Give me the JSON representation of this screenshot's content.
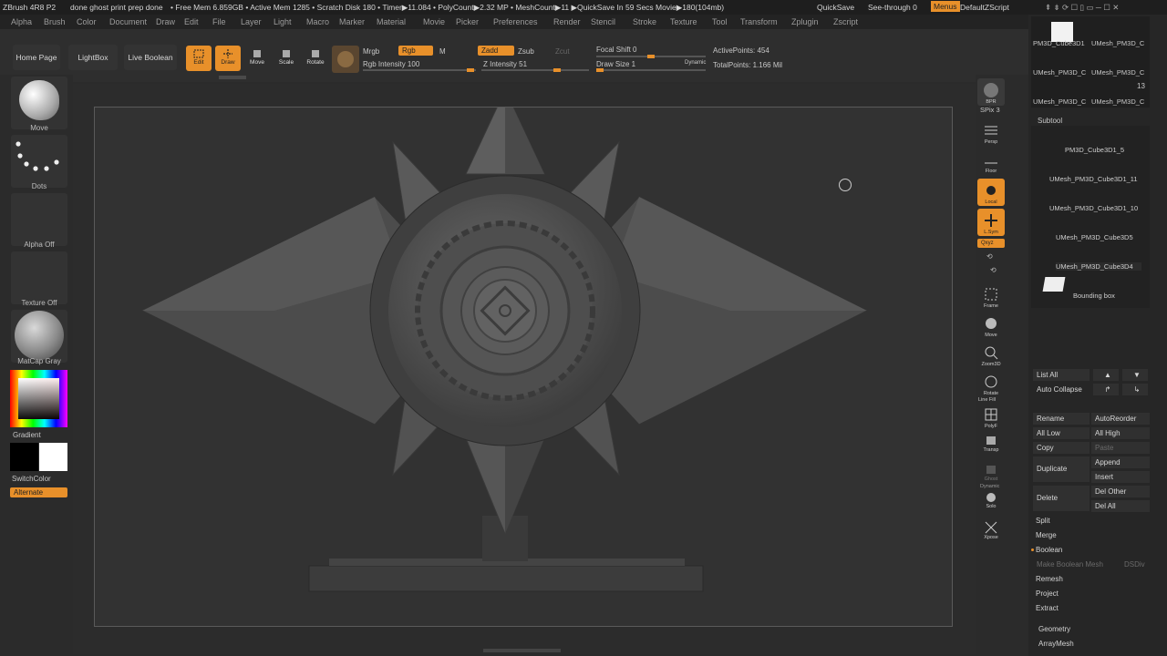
{
  "title_bar": {
    "app": "ZBrush 4R8 P2",
    "document": "done ghost print prep done",
    "stats": "• Free Mem 6.859GB • Active Mem 1285 • Scratch Disk 180 • Timer▶11.084 • PolyCount▶2.32 MP • MeshCount▶11 ▶QuickSave In 59 Secs Movie▶180(104mb)",
    "quicksave": "QuickSave",
    "see_through": "See-through  0",
    "menus": "Menus",
    "script": "DefaultZScript"
  },
  "menu_bar": [
    "Alpha",
    "Brush",
    "Color",
    "Document",
    "Draw",
    "Edit",
    "File",
    "Layer",
    "Light",
    "Macro",
    "Marker",
    "Material",
    "Movie",
    "Picker",
    "Preferences",
    "Render",
    "Stencil",
    "Stroke",
    "Texture",
    "Tool",
    "Transform",
    "Zplugin",
    "Zscript"
  ],
  "shelf": {
    "home_page": "Home Page",
    "lightbox": "LightBox",
    "live_boolean": "Live Boolean",
    "edit": "Edit",
    "draw": "Draw",
    "move": "Move",
    "scale": "Scale",
    "rotate": "Rotate",
    "mrgb": "Mrgb",
    "rgb": "Rgb",
    "m": "M",
    "rgb_intensity": "Rgb Intensity 100",
    "zadd": "Zadd",
    "zsub": "Zsub",
    "zcut": "Zcut",
    "z_intensity": "Z Intensity 51",
    "focal_shift": "Focal Shift 0",
    "draw_size": "Draw Size 1",
    "dynamic": "Dynamic",
    "active_points": "ActivePoints: 454",
    "total_points": "TotalPoints: 1.166 Mil"
  },
  "left_panel": {
    "brush": "Move",
    "stroke": "Dots",
    "alpha": "Alpha Off",
    "texture": "Texture Off",
    "material": "MatCap Gray",
    "gradient": "Gradient",
    "switch_color": "SwitchColor",
    "alternate": "Alternate"
  },
  "right_bar": {
    "bpr": "BPR",
    "spix": "SPix 3",
    "persp": "Persp",
    "floor": "Floor",
    "local": "Local",
    "lsym": "L.Sym",
    "xyz": "Qxyz",
    "frame": "Frame",
    "move": "Move",
    "zoom3d": "Zoom3D",
    "rotate": "Rotate",
    "line_fill": "Line Fill",
    "polyf": "PolyF",
    "transp": "Transp",
    "ghost": "Ghost",
    "dynamic": "Dynamic",
    "solo": "Solo",
    "xpose": "Xpose"
  },
  "tool_tray": {
    "thumbs": [
      "PM3D_Cube3D1",
      "UMesh_PM3D_C",
      "UMesh_PM3D_C",
      "UMesh_PM3D_C",
      "UMesh_PM3D_C",
      "UMesh_PM3D_C"
    ],
    "thumb_count": "13",
    "subtool_header": "Subtool",
    "subtools": [
      "PM3D_Cube3D1_5",
      "UMesh_PM3D_Cube3D1_11",
      "UMesh_PM3D_Cube3D1_10",
      "UMesh_PM3D_Cube3D5",
      "UMesh_PM3D_Cube3D4",
      "Bounding box"
    ],
    "list_all": "List All",
    "auto_collapse": "Auto Collapse",
    "rename": "Rename",
    "auto_reorder": "AutoReorder",
    "all_low": "All Low",
    "all_high": "All High",
    "copy": "Copy",
    "paste": "Paste",
    "duplicate": "Duplicate",
    "append": "Append",
    "insert": "Insert",
    "delete": "Delete",
    "del_other": "Del Other",
    "del_all": "Del All",
    "split": "Split",
    "merge": "Merge",
    "boolean": "Boolean",
    "make_boolean_mesh": "Make Boolean Mesh",
    "dsdiv": "DSDiv",
    "remesh": "Remesh",
    "project": "Project",
    "extract": "Extract",
    "geometry": "Geometry",
    "array_mesh": "ArrayMesh"
  },
  "colors": {
    "accent": "#e8902a",
    "panel": "#2b2b2b",
    "canvas": "#323232"
  }
}
